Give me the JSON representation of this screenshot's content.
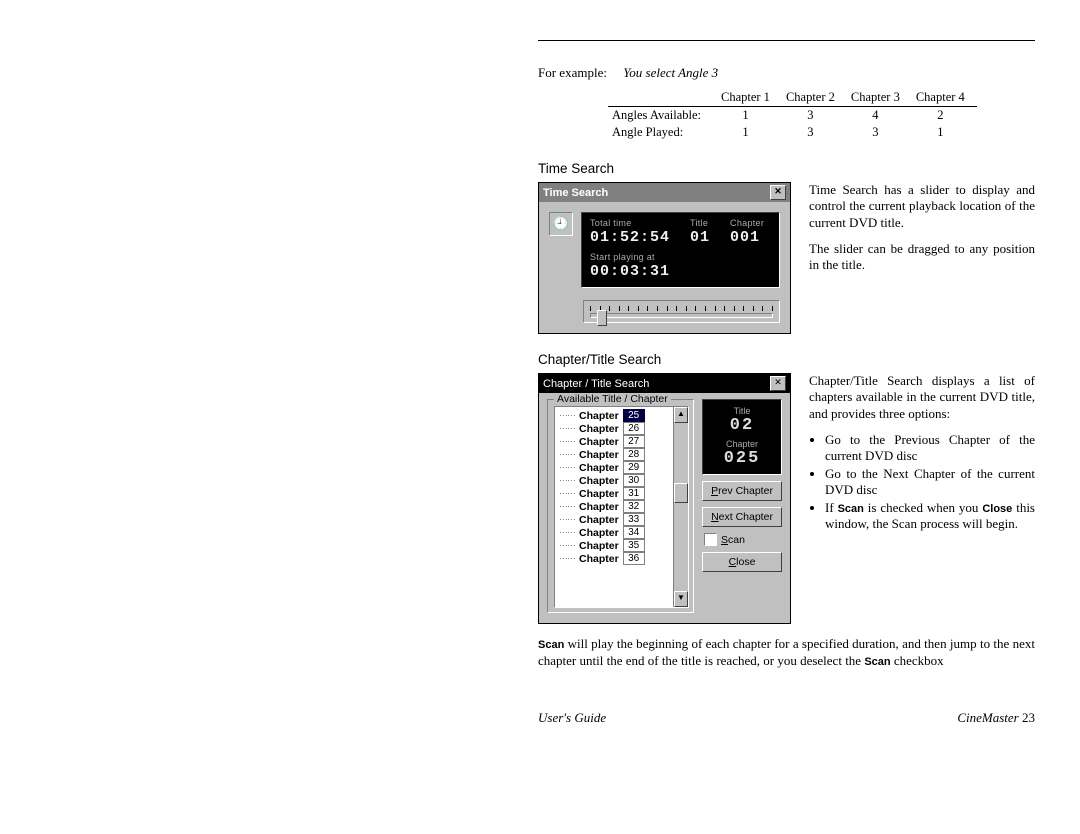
{
  "example": {
    "prefix": "For example:",
    "action": "You select Angle 3"
  },
  "angles_table": {
    "headers": [
      "Chapter 1",
      "Chapter 2",
      "Chapter 3",
      "Chapter 4"
    ],
    "rows": [
      {
        "label": "Angles Available:",
        "v": [
          "1",
          "3",
          "4",
          "2"
        ]
      },
      {
        "label": "Angle Played:",
        "v": [
          "1",
          "3",
          "3",
          "1"
        ]
      }
    ]
  },
  "sections": {
    "time_search": "Time Search",
    "chapter_search": "Chapter/Title Search"
  },
  "ts_dialog": {
    "title": "Time Search",
    "total_label": "Total time",
    "total_value": "01:52:54",
    "title_label": "Title",
    "title_value": "01",
    "chapter_label": "Chapter",
    "chapter_value": "001",
    "start_label": "Start playing at",
    "start_value": "00:03:31"
  },
  "ts_text": {
    "p1": "Time Search has a slider to display and control the current playback location of the current DVD title.",
    "p2": "The slider can be dragged to any position in the title."
  },
  "ct_dialog": {
    "title": "Chapter / Title Search",
    "group": "Available Title / Chapter",
    "chapters": [
      "25",
      "26",
      "27",
      "28",
      "29",
      "30",
      "31",
      "32",
      "33",
      "34",
      "35",
      "36"
    ],
    "selected_index": 0,
    "lcd_title_label": "Title",
    "lcd_title_value": "02",
    "lcd_chapter_label": "Chapter",
    "lcd_chapter_value": "025",
    "btn_prev": "Prev Chapter",
    "btn_next": "Next Chapter",
    "chk_scan": "Scan",
    "btn_close": "Close"
  },
  "ct_text": {
    "intro": "Chapter/Title Search displays a list of chapters available in the current DVD title, and provides three options:",
    "b1": "Go to the Previous Chapter of the current DVD disc",
    "b2": "Go to the Next Chapter of the current DVD disc",
    "b3_a": "If ",
    "b3_scan": "Scan",
    "b3_b": " is checked when you ",
    "b3_close": "Close",
    "b3_c": " this window, the Scan process will begin."
  },
  "scan_para": {
    "a": "Scan",
    "b": " will play the beginning of each chapter for a specified duration, and then jump to the next chapter until the end of the title is reached, or you deselect the ",
    "c": "Scan",
    "d": " checkbox"
  },
  "footer": {
    "left": "User's Guide",
    "right_a": "CineMaster",
    "right_b": "   23"
  }
}
